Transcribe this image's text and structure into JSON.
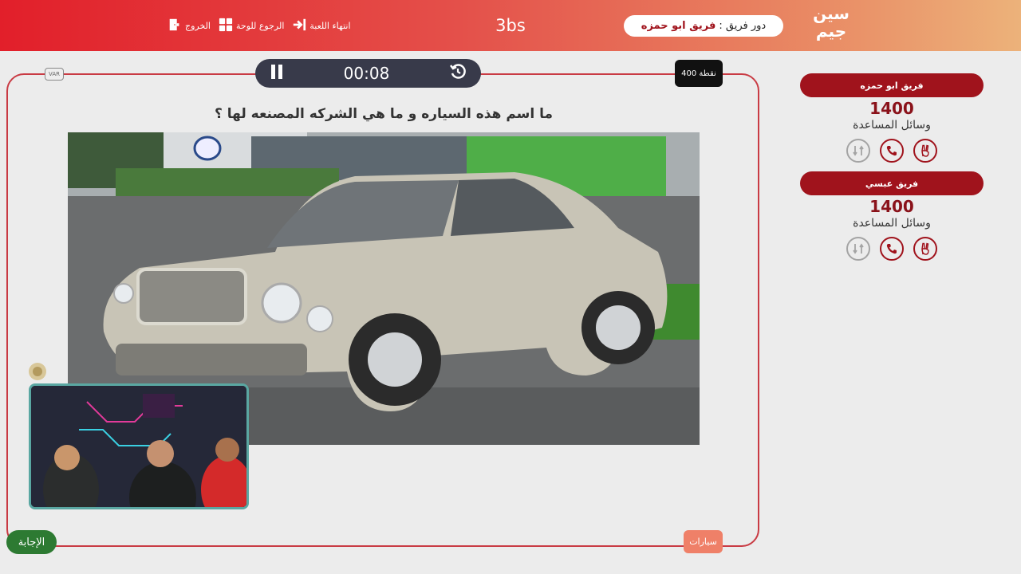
{
  "header": {
    "logo_text": "سين جيم",
    "turn_label": "دور فريق :",
    "turn_team": "فريق ابو حمزه",
    "room_code": "3bs",
    "nav": [
      {
        "label": "انتهاء اللعبة",
        "icon": "exit-arrow-icon"
      },
      {
        "label": "الرجوع للوحة",
        "icon": "grid-icon"
      },
      {
        "label": "الخروج",
        "icon": "door-icon"
      }
    ]
  },
  "question_panel": {
    "timer": "00:08",
    "points": "400 نقطة",
    "var_badge": "VAR",
    "question": "ما اسم هذه السياره و ما هي الشركه المصنعه لها ؟",
    "category": "سيارات",
    "answer_button": "الإجابة"
  },
  "teams": [
    {
      "name": "فريق ابو حمزه",
      "score": "1400",
      "help_label": "وسائل المساعدة"
    },
    {
      "name": "فريق عبسي",
      "score": "1400",
      "help_label": "وسائل المساعدة"
    }
  ],
  "colors": {
    "accent": "#a0131c",
    "header_start": "#e21f2a",
    "header_end": "#ecb27a",
    "answer": "#2d7a32",
    "category": "#ef8068"
  }
}
